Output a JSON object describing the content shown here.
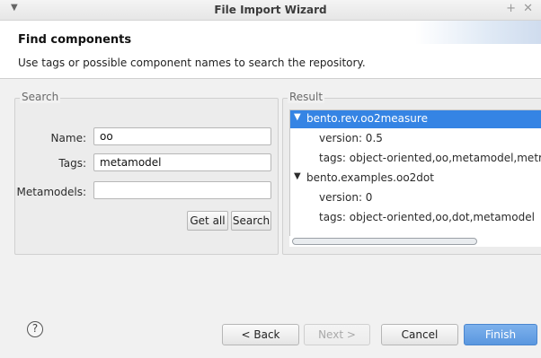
{
  "window": {
    "title": "File Import Wizard",
    "menu_icon": "chevron-down-icon",
    "pin_icon": "plus-icon",
    "close_icon": "close-icon"
  },
  "header": {
    "title": "Find components",
    "description": "Use tags or possible component names to search the repository."
  },
  "search": {
    "group_label": "Search",
    "name_label": "Name:",
    "name_value": "oo",
    "tags_label": "Tags:",
    "tags_value": "metamodel",
    "metamodels_label": "Metamodels:",
    "metamodels_value": "",
    "get_all_label": "Get all",
    "search_label": "Search"
  },
  "result": {
    "group_label": "Result",
    "items": [
      {
        "label": "bento.rev.oo2measure",
        "expanded": true,
        "selected": true,
        "children": [
          "version: 0.5",
          "tags: object-oriented,oo,metamodel,metrics"
        ]
      },
      {
        "label": "bento.examples.oo2dot",
        "expanded": true,
        "selected": false,
        "children": [
          "version: 0",
          "tags: object-oriented,oo,dot,metamodel"
        ]
      }
    ]
  },
  "footer": {
    "help_label": "?",
    "back_label": "< Back",
    "next_label": "Next >",
    "cancel_label": "Cancel",
    "finish_label": "Finish"
  },
  "colors": {
    "selection": "#3584e4",
    "primary_button": "#5a97df"
  }
}
